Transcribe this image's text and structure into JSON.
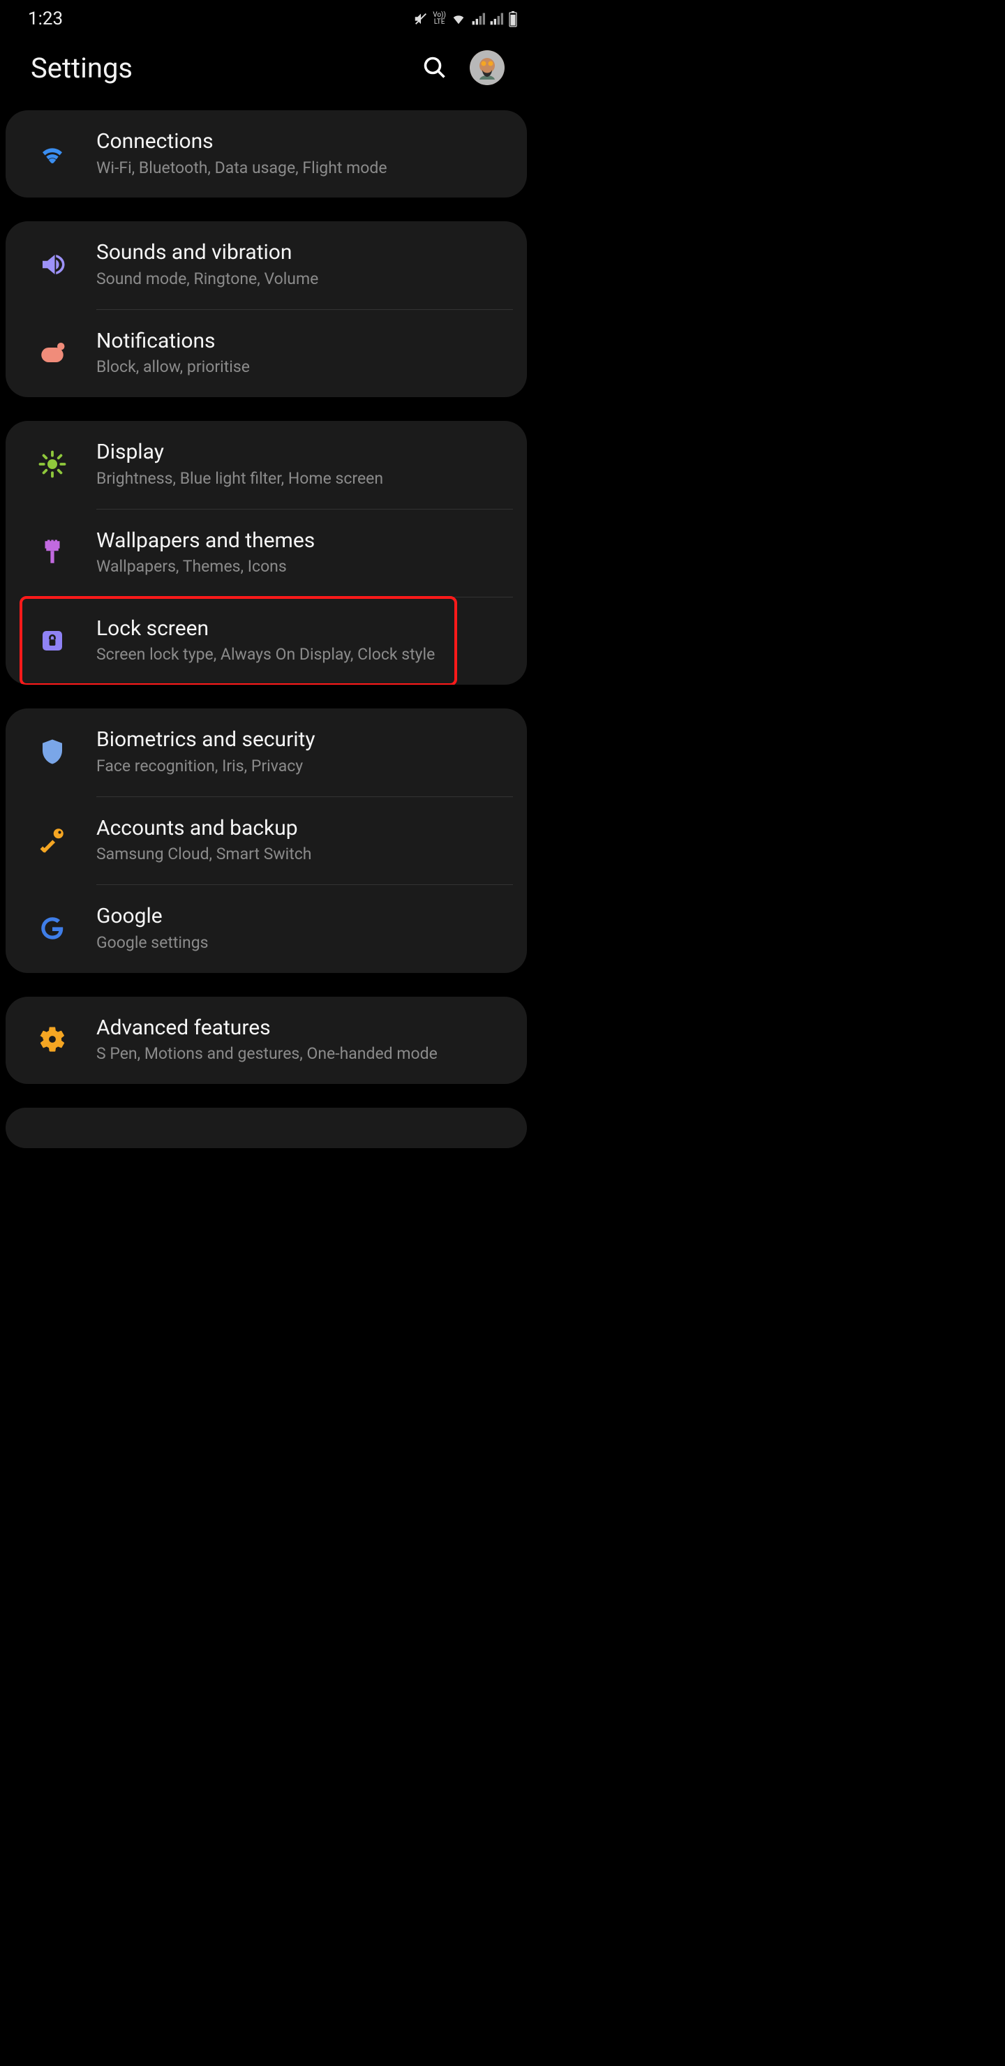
{
  "status": {
    "time": "1:23"
  },
  "header": {
    "title": "Settings"
  },
  "groups": [
    {
      "rows": [
        {
          "id": "connections",
          "title": "Connections",
          "sub": "Wi-Fi, Bluetooth, Data usage, Flight mode",
          "icon": "wifi",
          "iconClass": "ic-blue"
        }
      ]
    },
    {
      "rows": [
        {
          "id": "sounds",
          "title": "Sounds and vibration",
          "sub": "Sound mode, Ringtone, Volume",
          "icon": "speaker",
          "iconClass": "ic-purple"
        },
        {
          "id": "notifications",
          "title": "Notifications",
          "sub": "Block, allow, prioritise",
          "icon": "notif",
          "iconClass": "ic-salmon"
        }
      ]
    },
    {
      "rows": [
        {
          "id": "display",
          "title": "Display",
          "sub": "Brightness, Blue light filter, Home screen",
          "icon": "sun",
          "iconClass": "ic-lime"
        },
        {
          "id": "wallpapers",
          "title": "Wallpapers and themes",
          "sub": "Wallpapers, Themes, Icons",
          "icon": "brush",
          "iconClass": "ic-pink"
        },
        {
          "id": "lockscreen",
          "title": "Lock screen",
          "sub": "Screen lock type, Always On Display, Clock style",
          "icon": "lock",
          "iconClass": "ic-indigo",
          "highlight": true
        }
      ]
    },
    {
      "rows": [
        {
          "id": "biometrics",
          "title": "Biometrics and security",
          "sub": "Face recognition, Iris, Privacy",
          "icon": "shield",
          "iconClass": "ic-lblue"
        },
        {
          "id": "accounts",
          "title": "Accounts and backup",
          "sub": "Samsung Cloud, Smart Switch",
          "icon": "key",
          "iconClass": "ic-orange"
        },
        {
          "id": "google",
          "title": "Google",
          "sub": "Google settings",
          "icon": "google",
          "iconClass": "ic-gblue"
        }
      ]
    },
    {
      "rows": [
        {
          "id": "advanced",
          "title": "Advanced features",
          "sub": "S Pen, Motions and gestures, One-handed mode",
          "icon": "gear",
          "iconClass": "ic-orange"
        }
      ]
    },
    {
      "rows": [
        {
          "id": "placeholder",
          "title": " ",
          "sub": "",
          "icon": "",
          "iconClass": ""
        }
      ]
    }
  ]
}
